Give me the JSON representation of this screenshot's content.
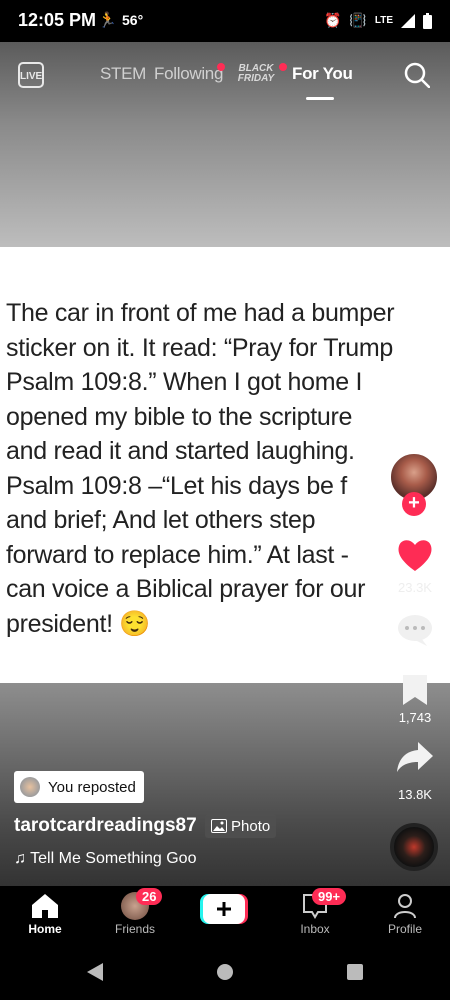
{
  "status_bar": {
    "time": "12:05 PM",
    "temperature": "56°",
    "network": "LTE"
  },
  "top_nav": {
    "live_label": "LIVE",
    "tabs": [
      {
        "label": "STEM"
      },
      {
        "label": "Following"
      },
      {
        "label": "BLACK FRIDAY"
      },
      {
        "label": "For You"
      }
    ],
    "active_tab": "For You"
  },
  "post": {
    "text": "The car in front of me had a bumper sticker on it. It read: “Pray for Trump Psalm 109:8.” When I got home I opened my bible to the scripture and read it and started laughing. Psalm 109:8 –“Let his days be f and brief; And let others step forward to replace him.” At last - can voice a Biblical prayer for our president! 😌",
    "lines": [
      "The car in front of me had a bumper",
      "sticker on it. It read: “Pray for Trump",
      "Psalm 109:8.” When I got home I",
      "opened my bible to the scripture",
      "and read it and started laughing.",
      "Psalm 109:8 –“Let his days be f",
      "and brief; And let others step",
      "forward to replace him.” At last -",
      "can voice a Biblical prayer for our",
      "president! 😌"
    ],
    "reposted_label": "You reposted",
    "username": "tarotcardreadings87",
    "photo_badge": "Photo",
    "sound": "Tell Me Something Goo"
  },
  "actions": {
    "likes": "23.3K",
    "saves": "1,743",
    "shares": "13.8K"
  },
  "bottom_nav": {
    "home": "Home",
    "friends": "Friends",
    "friends_badge": "26",
    "inbox": "Inbox",
    "inbox_badge": "99+",
    "profile": "Profile"
  },
  "colors": {
    "accent": "#fe2c55",
    "plus_left": "#25f4ee",
    "plus_right": "#fe2c55"
  }
}
